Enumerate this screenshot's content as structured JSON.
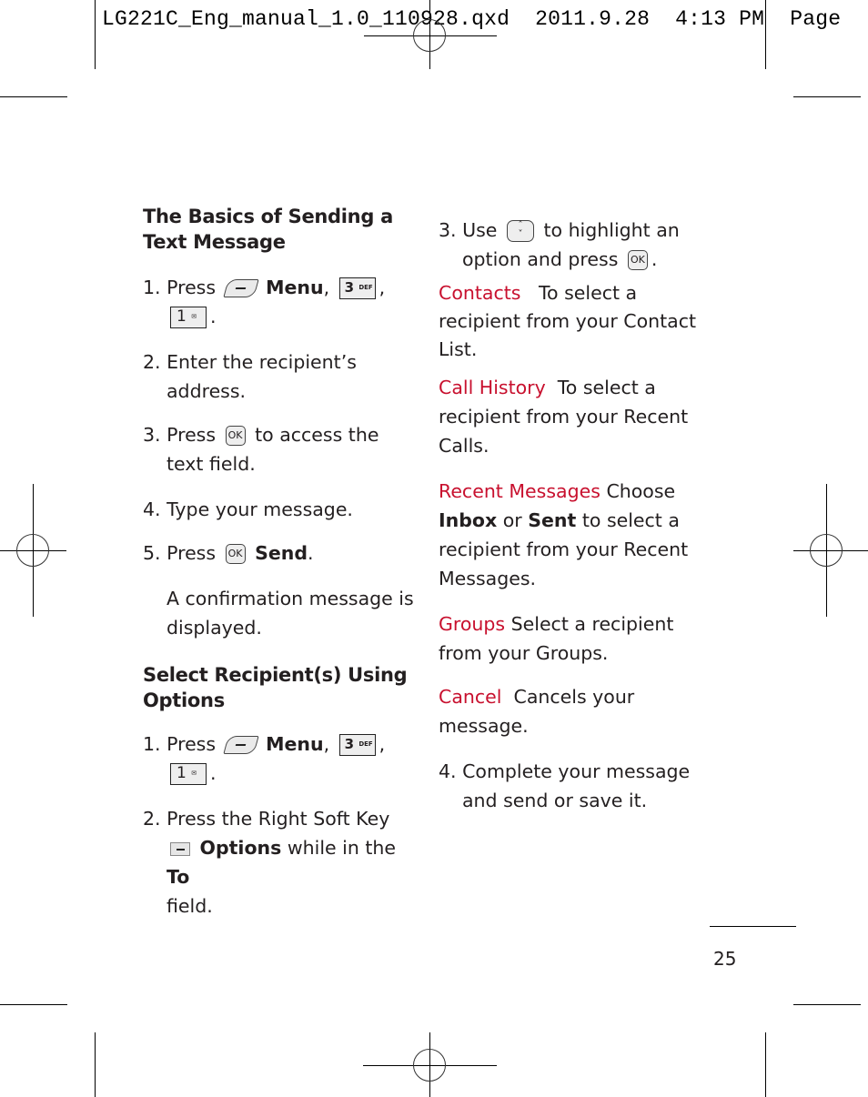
{
  "slug": {
    "filename": "LG221C_Eng_manual_1.0_110928.qxd",
    "date": "2011.9.28",
    "time": "4:13",
    "ampm": "PM",
    "page_label": "Page"
  },
  "left_column": {
    "heading1": "The Basics of Sending a Text Message",
    "steps1": [
      {
        "num": "1.",
        "text_a": "Press",
        "key1": "left-soft-key",
        "bold": "Menu",
        "sep": ",",
        "key2": "3",
        "key2_sub": "DEF",
        "key3": "1",
        "end": "."
      },
      {
        "num": "2.",
        "text": "Enter the recipient’s address."
      },
      {
        "num": "3.",
        "text_a": "Press",
        "key": "OK",
        "text_b": "to access the text field."
      },
      {
        "num": "4.",
        "text": "Type your message."
      },
      {
        "num": "5.",
        "text_a": "Press",
        "key": "OK",
        "bold": "Send",
        "end": "."
      }
    ],
    "confirmation": "A confirmation message is displayed.",
    "heading2": "Select Recipient(s) Using Options",
    "steps2": [
      {
        "num": "1.",
        "text_a": "Press",
        "bold": "Menu",
        "sep": ",",
        "key2": "3",
        "key2_sub": "DEF",
        "key3": "1",
        "end": "."
      },
      {
        "num": "2.",
        "text_a": "Press the Right Soft Key",
        "bold": "Options",
        "text_b": "while in the",
        "bold2": "To",
        "text_c": "field."
      }
    ]
  },
  "right_column": {
    "step3": {
      "num": "3.",
      "text_a": "Use",
      "text_b": "to highlight an option and press",
      "key": "OK",
      "end": "."
    },
    "options": [
      {
        "label": "Contacts",
        "desc": "To select a recipient from your Contact List."
      },
      {
        "label": "Call History",
        "desc": "To select a recipient from your Recent Calls."
      },
      {
        "label": "Recent Messages",
        "desc_a": "Choose",
        "bold1": "Inbox",
        "mid": "or",
        "bold2": "Sent",
        "desc_b": "to select a recipient from your Recent Messages."
      },
      {
        "label": "Groups",
        "desc": "Select a recipient from your Groups."
      },
      {
        "label": "Cancel",
        "desc": "Cancels your message."
      }
    ],
    "step4": {
      "num": "4.",
      "text": "Complete your message and send or save it."
    }
  },
  "page_number": "25",
  "colors": {
    "accent": "#c8102e",
    "text": "#231f20"
  }
}
